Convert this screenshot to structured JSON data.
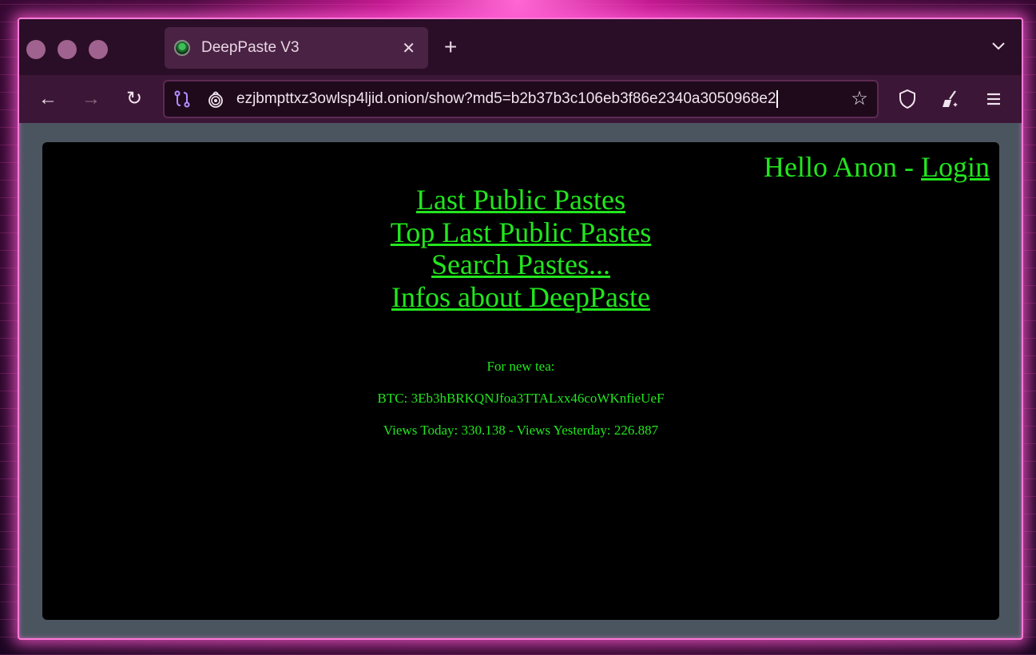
{
  "browser": {
    "tab": {
      "title": "DeepPaste V3",
      "close_glyph": "✕"
    },
    "new_tab_glyph": "+",
    "url": "ezjbmpttxz3owlsp4ljid.onion/show?md5=b2b37b3c106eb3f86e2340a3050968e2",
    "nav_glyphs": {
      "back": "←",
      "forward": "→",
      "reload": "↻",
      "bookmark": "☆"
    },
    "icons": [
      "tor-circuit-icon",
      "onion-lock-icon",
      "shield-icon",
      "broom-icon",
      "hamburger-menu-icon",
      "tabs-dropdown-icon"
    ]
  },
  "page": {
    "greeting_prefix": "Hello Anon - ",
    "login_link": "Login",
    "nav_links": [
      "Last Public Pastes",
      "Top Last Public Pastes",
      "Search Pastes...",
      "Infos about DeepPaste"
    ],
    "donation_label": "For new tea:",
    "btc": "BTC: 3Eb3hBRKQNJfoa3TTALxx46coWKnfieUeF",
    "views": "Views Today: 330.138 - Views Yesterday: 226.887"
  },
  "colors": {
    "text_green": "#22e61e",
    "window_glow": "#ff7ad9",
    "chrome_bg": "#2a0d26"
  }
}
